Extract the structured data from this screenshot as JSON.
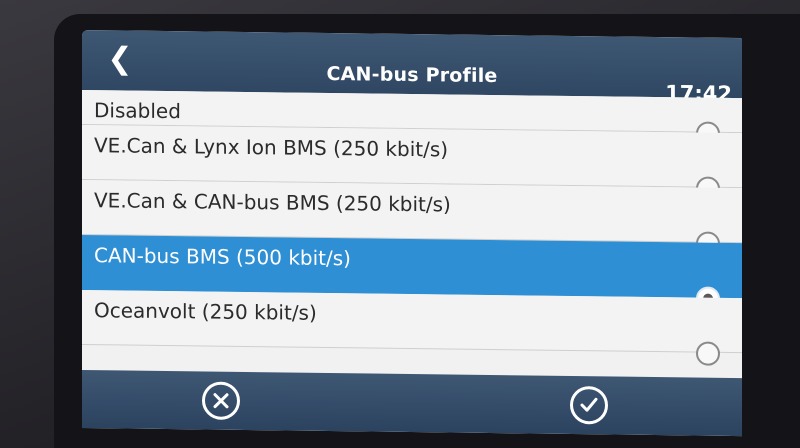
{
  "header": {
    "back_icon": "chevron-left-icon",
    "title": "CAN-bus Profile",
    "time": "17:42"
  },
  "profiles": [
    {
      "label": "Disabled",
      "selected": false
    },
    {
      "label": "VE.Can & Lynx Ion BMS (250 kbit/s)",
      "selected": false
    },
    {
      "label": "VE.Can & CAN-bus BMS (250 kbit/s)",
      "selected": false
    },
    {
      "label": "CAN-bus BMS (500 kbit/s)",
      "selected": true
    },
    {
      "label": "Oceanvolt (250 kbit/s)",
      "selected": false
    }
  ],
  "footer": {
    "cancel_icon": "cancel-circle-x-icon",
    "confirm_icon": "confirm-circle-check-icon"
  },
  "colors": {
    "header_bg": "#34506e",
    "selected_row": "#2e8fd4",
    "row_bg": "#f3f3f3"
  }
}
